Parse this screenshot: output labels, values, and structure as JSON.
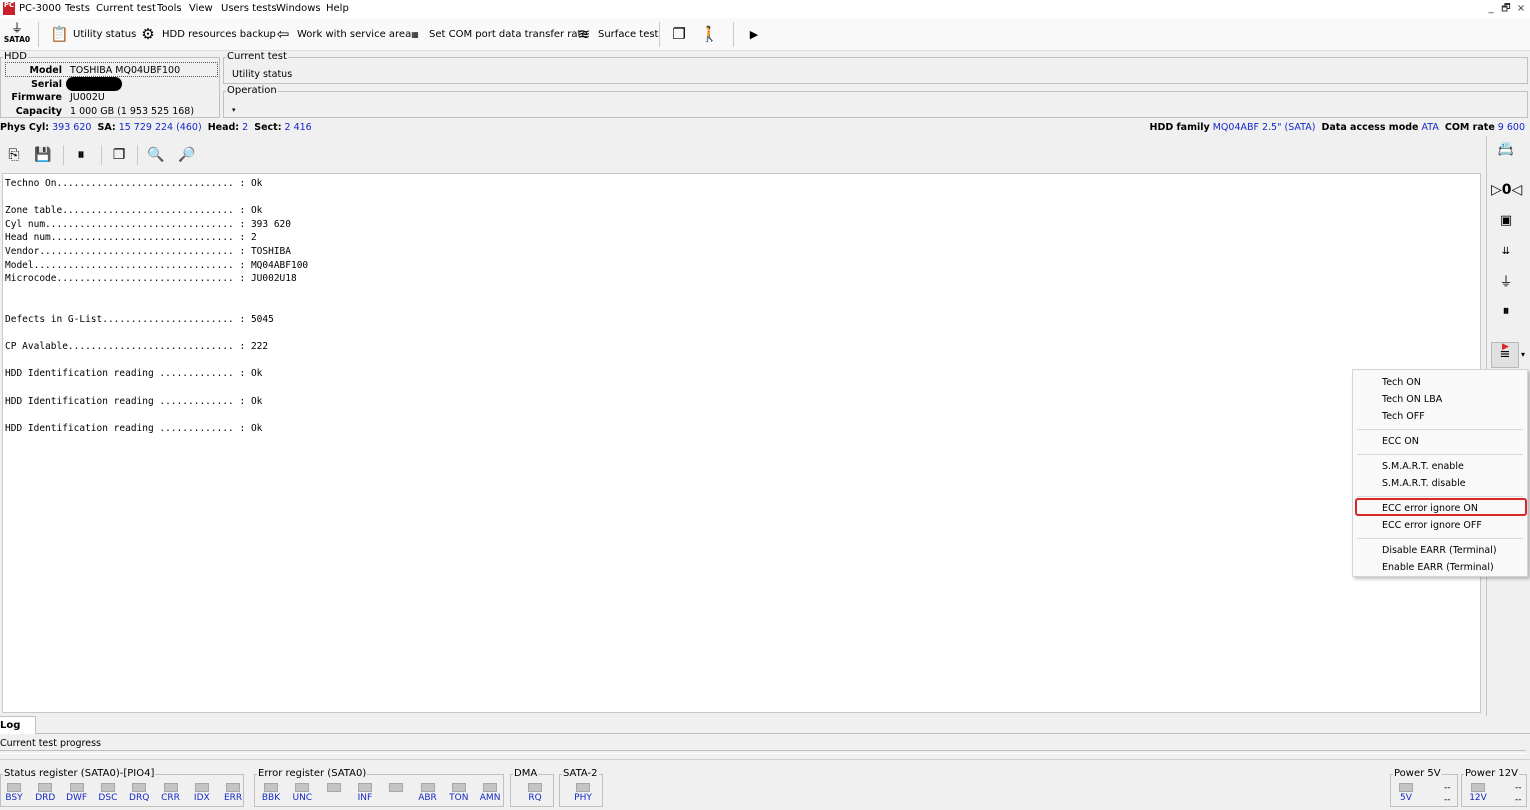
{
  "menubar": {
    "logo": "PC",
    "app_title": "PC-3000",
    "items": [
      "Tests",
      "Current test",
      "Tools",
      "View",
      "Users tests",
      "Windows",
      "Help"
    ],
    "window_controls": [
      "_",
      "🗗",
      "×"
    ]
  },
  "toolbar": {
    "sata_label": "SATA0",
    "buttons": [
      "Utility status",
      "HDD resources backup",
      "Work with service area",
      "Set COM port data transfer rate",
      "Surface test"
    ]
  },
  "hdd": {
    "legend": "HDD",
    "model_label": "Model",
    "model": "TOSHIBA MQ04UBF100",
    "serial_label": "Serial",
    "serial": "",
    "firmware_label": "Firmware",
    "firmware": "JU002U",
    "capacity_label": "Capacity",
    "capacity": "1 000 GB (1 953 525 168)"
  },
  "current_test": {
    "legend": "Current test",
    "value": "Utility status"
  },
  "operation": {
    "legend": "Operation",
    "value": ""
  },
  "geometry": {
    "phys_cyl_label": "Phys Cyl:",
    "phys_cyl": "393 620",
    "sa_label": "SA:",
    "sa": "15 729 224 (460)",
    "head_label": "Head:",
    "head": "2",
    "sect_label": "Sect:",
    "sect": "2 416",
    "family_label": "HDD family",
    "family": "MQ04ABF 2.5\" (SATA)",
    "access_label": "Data access mode",
    "access": "ATA",
    "com_label": "COM rate",
    "com": "9 600"
  },
  "log_lines": [
    "Techno On............................... : Ok",
    "",
    "Zone table.............................. : Ok",
    "Cyl num................................. : 393 620",
    "Head num................................ : 2",
    "Vendor.................................. : TOSHIBA",
    "Model................................... : MQ04ABF100",
    "Microcode............................... : JU002U18",
    "",
    "",
    "Defects in G-List....................... : 5045",
    "",
    "CP Avalable............................. : 222",
    "",
    "HDD Identification reading ............. : Ok",
    "",
    "HDD Identification reading ............. : Ok",
    "",
    "HDD Identification reading ............. : Ok"
  ],
  "context_menu": {
    "items": [
      "Tech ON",
      "Tech ON LBA",
      "Tech OFF",
      "ECC ON",
      "S.M.A.R.T. enable",
      "S.M.A.R.T. disable",
      "ECC error ignore ON",
      "ECC error ignore OFF",
      "Disable EARR (Terminal)",
      "Enable EARR (Terminal)"
    ],
    "highlighted": "ECC error ignore ON",
    "highlight_color": "#d62828"
  },
  "log_tab": "Log",
  "progress_label": "Current test progress",
  "status_register": {
    "legend": "Status register (SATA0)-[PIO4]",
    "flags": [
      "BSY",
      "DRD",
      "DWF",
      "DSC",
      "DRQ",
      "CRR",
      "IDX",
      "ERR"
    ]
  },
  "error_register": {
    "legend": "Error register (SATA0)",
    "flags": [
      "BBK",
      "UNC",
      "",
      "INF",
      "",
      "ABR",
      "TON",
      "AMN"
    ]
  },
  "dma": {
    "legend": "DMA",
    "flags": [
      "RQ"
    ]
  },
  "sata2": {
    "legend": "SATA-2",
    "flags": [
      "PHY"
    ]
  },
  "power5": {
    "legend": "Power 5V",
    "flag": "5V",
    "value": "--"
  },
  "power12": {
    "legend": "Power 12V",
    "flag": "12V",
    "value": "--"
  },
  "colors": {
    "value_blue": "#1428c8",
    "logo_red": "#c8232c"
  }
}
